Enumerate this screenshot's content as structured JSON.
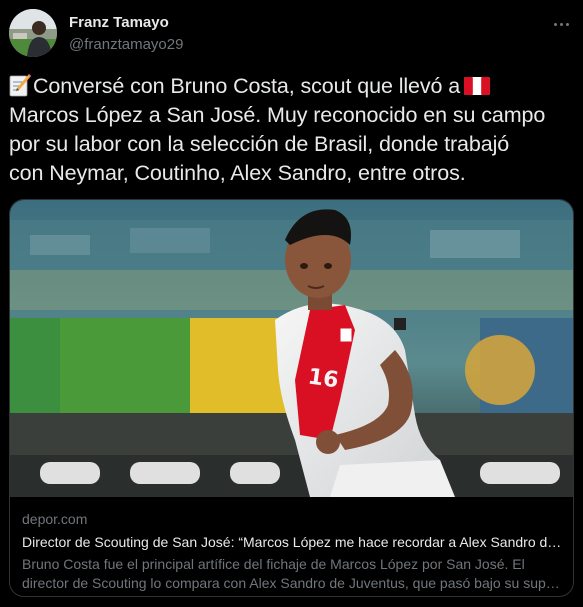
{
  "author": {
    "name": "Franz Tamayo",
    "handle": "@franztamayo29"
  },
  "icons": {
    "avatar": "user-avatar",
    "more": "more-options-icon",
    "memo": "memo-emoji-icon",
    "flag": "peru-flag-icon"
  },
  "tweet": {
    "line1_text": "Conversé con Bruno Costa, scout que llevó a",
    "line2": "Marcos López a San José. Muy reconocido en su campo",
    "line3": "por su labor con la selección de Brasil, donde trabajó",
    "line4": "con Neymar, Coutinho, Alex Sandro, entre otros."
  },
  "card": {
    "domain": "depor.com",
    "title": "Director de Scouting de San José: “Marcos López me hace recordar a Alex Sandro de Juventus”",
    "desc_line1": "Bruno Costa fue el principal artífice del fichaje de Marcos López por San José. El",
    "desc_line2": "director de Scouting lo compara con Alex Sandro de Juventus, que pasó bajo su supervisión",
    "player_number": "16"
  },
  "colors": {
    "background": "#000000",
    "text_primary": "#e7e9ea",
    "text_secondary": "#71767b",
    "border": "#2f3336",
    "peru_red": "#d91023"
  }
}
